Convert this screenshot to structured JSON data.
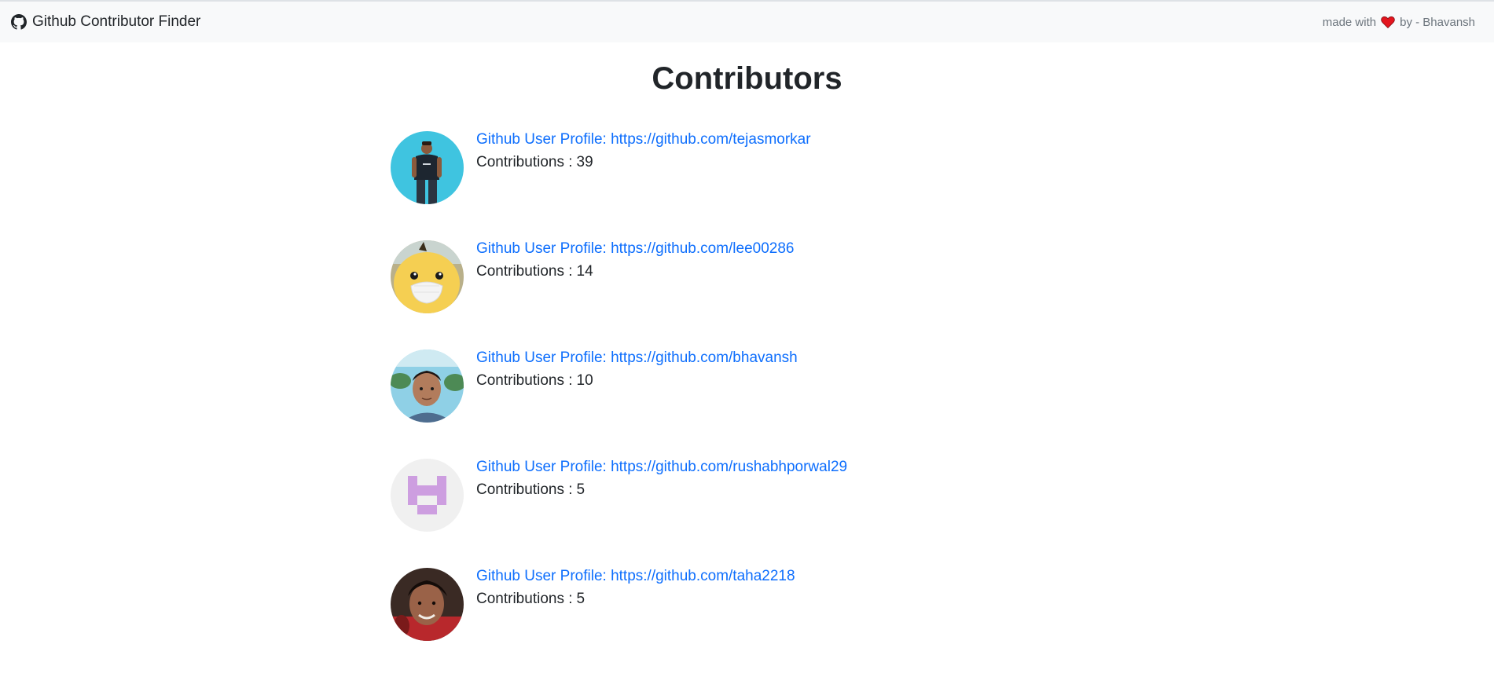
{
  "navbar": {
    "brand_label": "Github Contributor Finder",
    "brand_icon": "github-icon",
    "credit_prefix": "made with",
    "credit_icon": "heart-icon",
    "credit_suffix": "by - Bhavansh",
    "heart_color": "#e3151e"
  },
  "page": {
    "title": "Contributors"
  },
  "contributors": [
    {
      "link_text": "Github User Profile: https://github.com/tejasmorkar",
      "contributions_label": "Contributions :",
      "contributions": "39"
    },
    {
      "link_text": "Github User Profile: https://github.com/lee00286",
      "contributions_label": "Contributions :",
      "contributions": "14"
    },
    {
      "link_text": "Github User Profile: https://github.com/bhavansh",
      "contributions_label": "Contributions :",
      "contributions": "10"
    },
    {
      "link_text": "Github User Profile: https://github.com/rushabhporwal29",
      "contributions_label": "Contributions :",
      "contributions": "5"
    },
    {
      "link_text": "Github User Profile: https://github.com/taha2218",
      "contributions_label": "Contributions :",
      "contributions": "5"
    }
  ],
  "colors": {
    "link": "#0d6efd",
    "navbar_bg": "#f8f9fa",
    "text": "#212529",
    "muted": "#6c757d"
  }
}
